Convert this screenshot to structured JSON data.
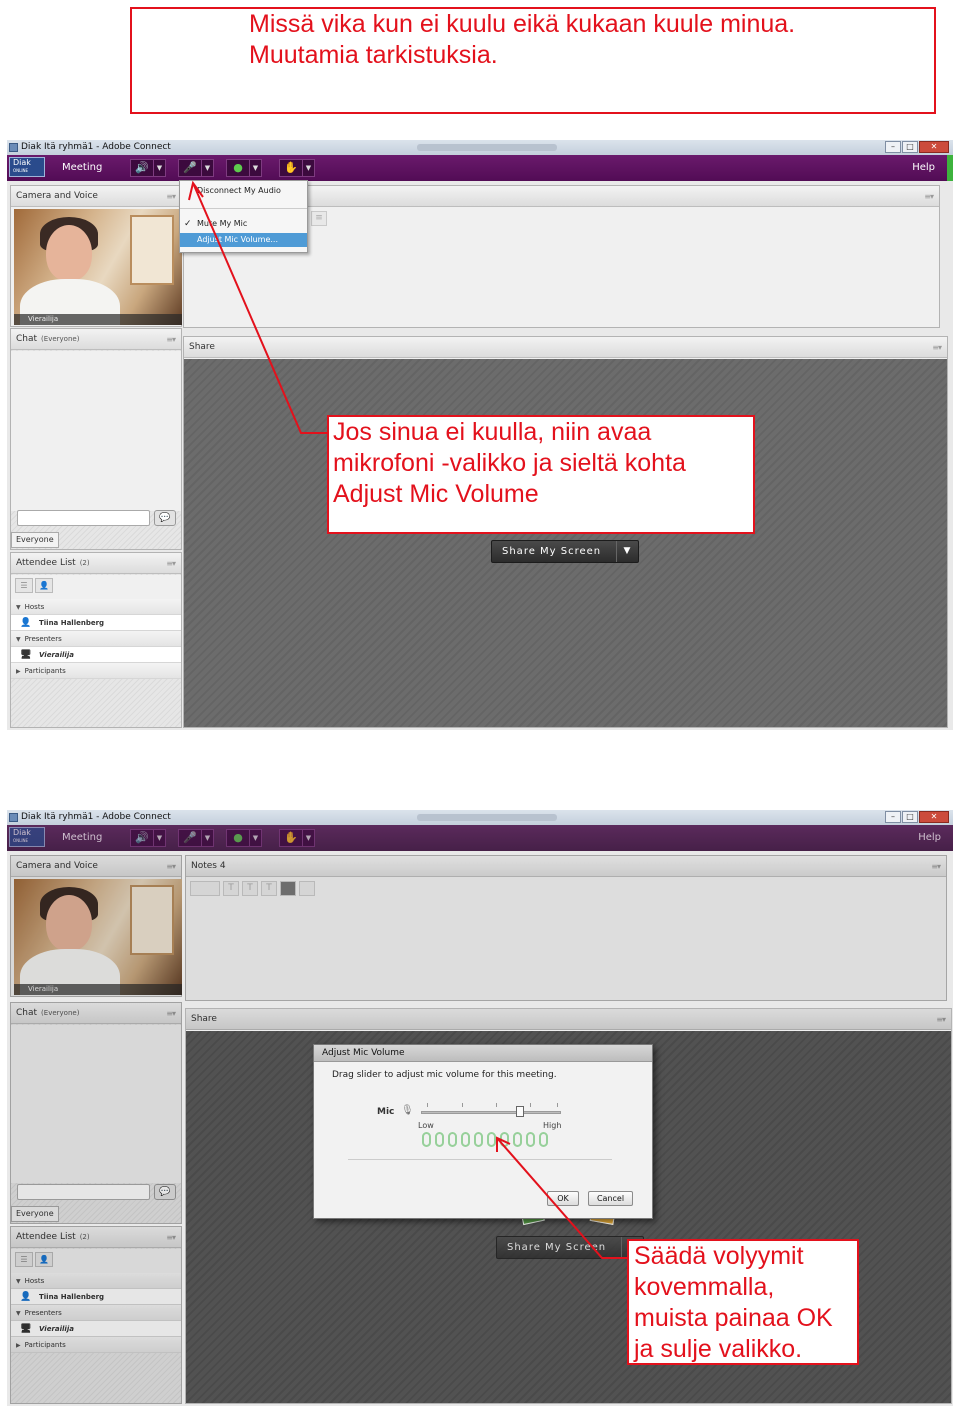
{
  "annotations": {
    "top_line1": "Missä vika kun ei kuulu eikä kukaan kuule minua.",
    "top_line2": "Muutamia tarkistuksia.",
    "mid_line1": "Jos sinua ei kuulla, niin avaa",
    "mid_line2": "mikrofoni -valikko ja sieltä kohta",
    "mid_line3": "Adjust Mic Volume",
    "bot_line1": "Säädä volyymit",
    "bot_line2": "kovemmalla,",
    "bot_line3": "muista painaa OK",
    "bot_line4": "ja sulje valikko.",
    "color": "#e3111c"
  },
  "window": {
    "title": "Diak Itä ryhmä1 - Adobe Connect",
    "logo_text": "Diak",
    "logo_sub": "ONLINE",
    "menu_meeting": "Meeting",
    "menu_help": "Help",
    "toolbar_icons": [
      "speaker-icon",
      "microphone-icon",
      "webcam-icon",
      "raise-hand-icon"
    ],
    "accent": "#5a0f5d"
  },
  "camera_pod": {
    "title": "Camera and Voice",
    "participant_name": "Vierailija"
  },
  "notes_pod": {
    "title": "Notes 4",
    "toolbar": [
      "",
      "T",
      "T",
      "T",
      "",
      ""
    ]
  },
  "chat_pod": {
    "title": "Chat",
    "scope": "(Everyone)",
    "tab_label": "Everyone"
  },
  "share_pod": {
    "title": "Share",
    "share_button": "Share My Screen"
  },
  "attendee_pod": {
    "title": "Attendee List",
    "count": "(2)",
    "groups": {
      "hosts": "Hosts",
      "presenters": "Presenters",
      "participants": "Participants"
    },
    "host_name": "Tiina Hallenberg",
    "presenter_name": "Vierailija"
  },
  "mic_menu": {
    "items": [
      "Disconnect My Audio",
      "Mute My Mic",
      "Adjust Mic Volume..."
    ],
    "checked": "Mute My Mic",
    "highlighted": "Adjust Mic Volume..."
  },
  "mic_dialog": {
    "title": "Adjust Mic Volume",
    "message": "Drag slider to adjust mic volume for this meeting.",
    "mic_label": "Mic",
    "low_label": "Low",
    "high_label": "High",
    "slider_value": 0.71,
    "ok": "OK",
    "cancel": "Cancel"
  }
}
